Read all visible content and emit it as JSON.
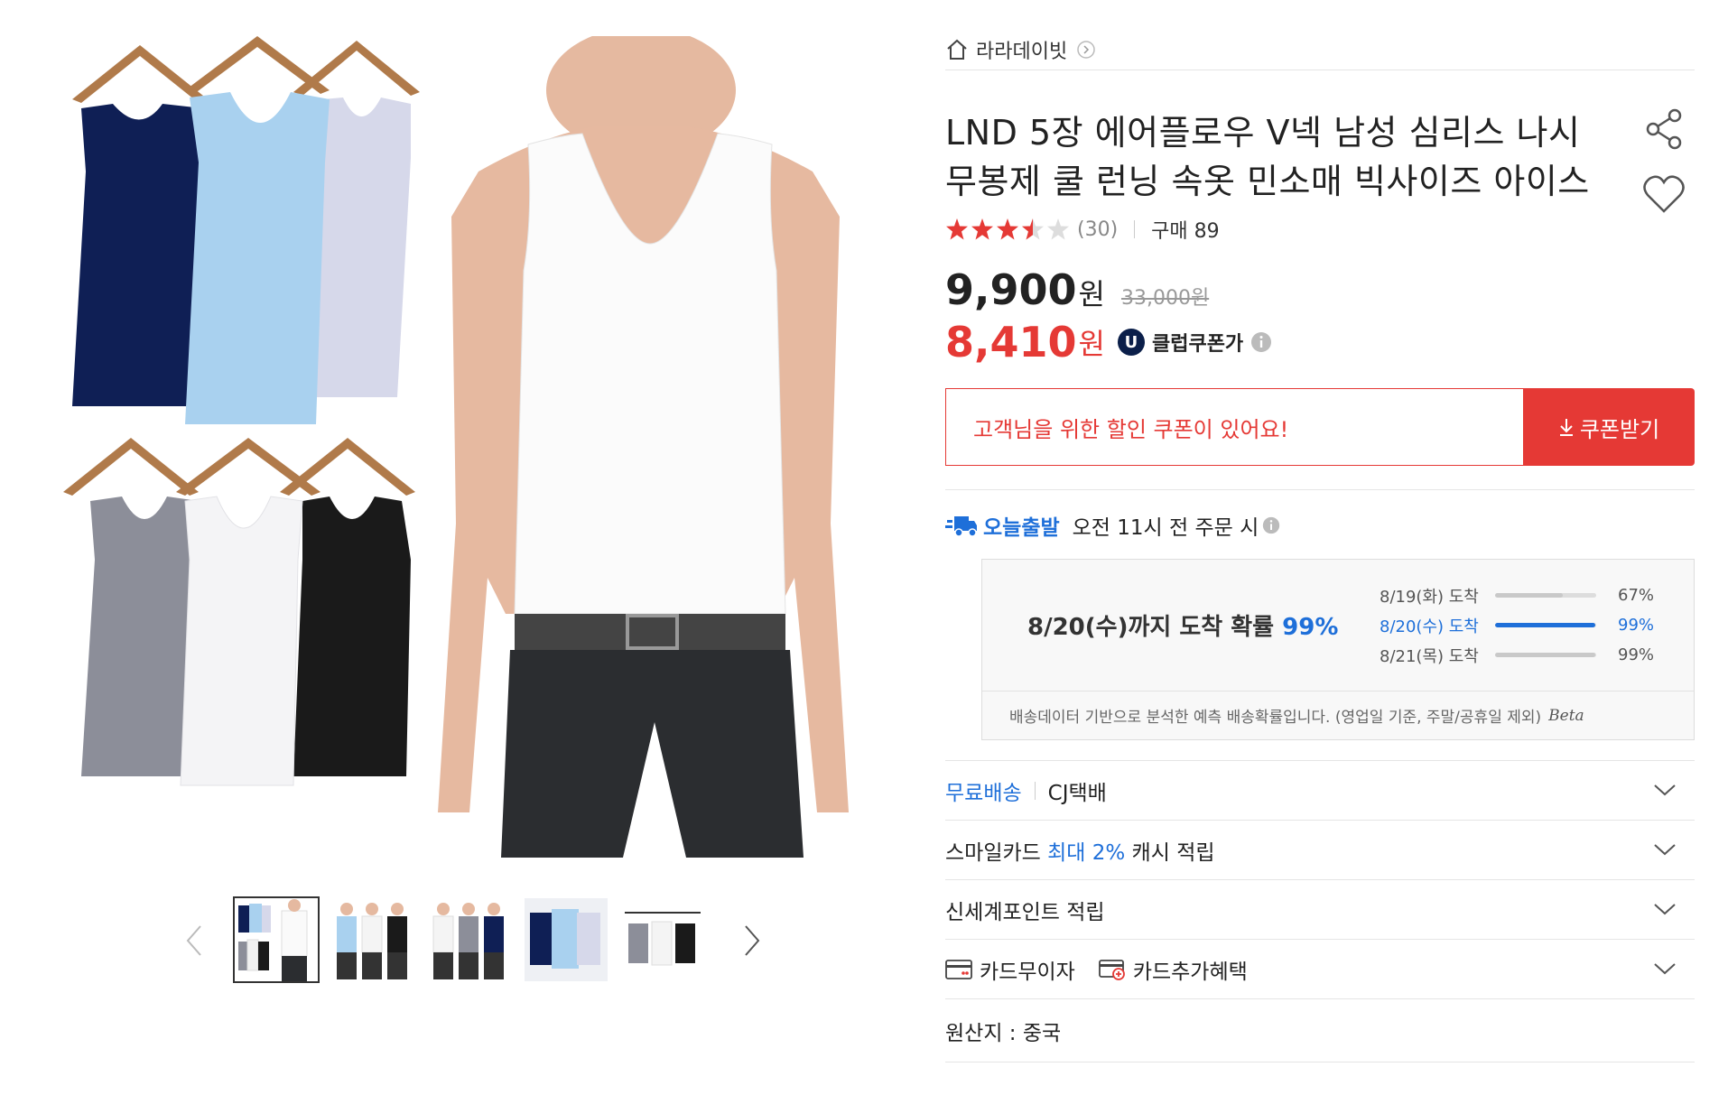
{
  "store": {
    "name": "라라데이빗"
  },
  "product": {
    "title": "LND 5장 에어플로우 V넥 남성 심리스 나시 무봉제 쿨 런닝 속옷 민소매 빅사이즈 아이스",
    "rating": 3.5,
    "review_count": "(30)",
    "purchase": "구매 89",
    "price": "9,900",
    "price_unit": "원",
    "original_price": "33,000원",
    "coupon_price": "8,410",
    "coupon_unit": "원",
    "club_badge": "U",
    "club_label": "클럽쿠폰가"
  },
  "coupon": {
    "message": "고객님을 위한 할인 쿠폰이 있어요!",
    "button": "쿠폰받기"
  },
  "delivery": {
    "today_label": "오늘출발",
    "cutoff": "오전 11시 전 주문 시",
    "headline_prefix": "8/20(수)까지 도착 확률 ",
    "headline_pct": "99%",
    "rows": [
      {
        "date": "8/19(화) 도착",
        "pct_label": "67%",
        "value": 0.67,
        "highlight": false
      },
      {
        "date": "8/20(수) 도착",
        "pct_label": "99%",
        "value": 0.99,
        "highlight": true
      },
      {
        "date": "8/21(목) 도착",
        "pct_label": "99%",
        "value": 0.99,
        "highlight": false
      }
    ],
    "note": "배송데이터 기반으로 분석한 예측 배송확률입니다. (영업일 기준, 주말/공휴일 제외)",
    "beta": "Beta"
  },
  "options": {
    "shipping_free": "무료배송",
    "courier": "CJ택배",
    "smile_prefix": "스마일카드 ",
    "smile_highlight": "최대 2%",
    "smile_suffix": " 캐시 적립",
    "shinsegae": "신세계포인트 적립",
    "card_interest": "카드무이자",
    "card_benefit": "카드추가혜택",
    "origin": "원산지 : 중국"
  },
  "colors": {
    "accent_red": "#e53935",
    "accent_blue": "#1e6fd9",
    "navy": "#0b1f4a"
  },
  "gallery": {
    "thumbnail_count": 5,
    "active_index": 0
  }
}
